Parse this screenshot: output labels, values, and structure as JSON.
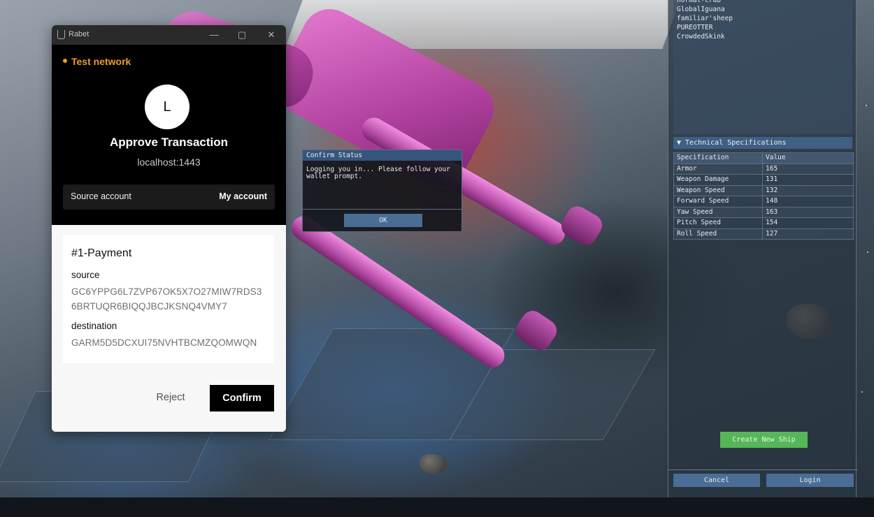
{
  "rabet": {
    "app_name": "Rabet",
    "window_controls": {
      "minimize": "—",
      "maximize": "▢",
      "close": "✕"
    },
    "network": "Test network",
    "avatar_letter": "L",
    "title": "Approve Transaction",
    "host": "localhost:1443",
    "source_account_label": "Source account",
    "source_account_value": "My account",
    "operation": {
      "title": "#1-Payment",
      "source_label": "source",
      "source_value": "GC6YPPG6L7ZVP67OK5X7O27MIW7RDS36BRTUQR6BIQQJBCJKSNQ4VMY7",
      "destination_label": "destination",
      "destination_value": "GARM5D5DCXUI75NVHTBCMZQOMWQN"
    },
    "reject_label": "Reject",
    "confirm_label": "Confirm"
  },
  "confirm_status": {
    "title": "Confirm Status",
    "message": "Logging you in... Please follow your wallet prompt.",
    "ok_label": "OK"
  },
  "game_panel": {
    "players": [
      "normal-crab",
      "GlobalIguana",
      "familiar'sheep",
      "PUREOTTER",
      "CrowdedSkink"
    ],
    "spec_header": "▼ Technical Specifications",
    "spec_columns": [
      "Specification",
      "Value"
    ],
    "specs": [
      [
        "Armor",
        "165"
      ],
      [
        "Weapon Damage",
        "131"
      ],
      [
        "Weapon Speed",
        "132"
      ],
      [
        "Forward Speed",
        "148"
      ],
      [
        "Yaw Speed",
        "163"
      ],
      [
        "Pitch Speed",
        "154"
      ],
      [
        "Roll Speed",
        "127"
      ]
    ],
    "create_label": "Create New Ship",
    "cancel_label": "Cancel",
    "login_label": "Login"
  }
}
